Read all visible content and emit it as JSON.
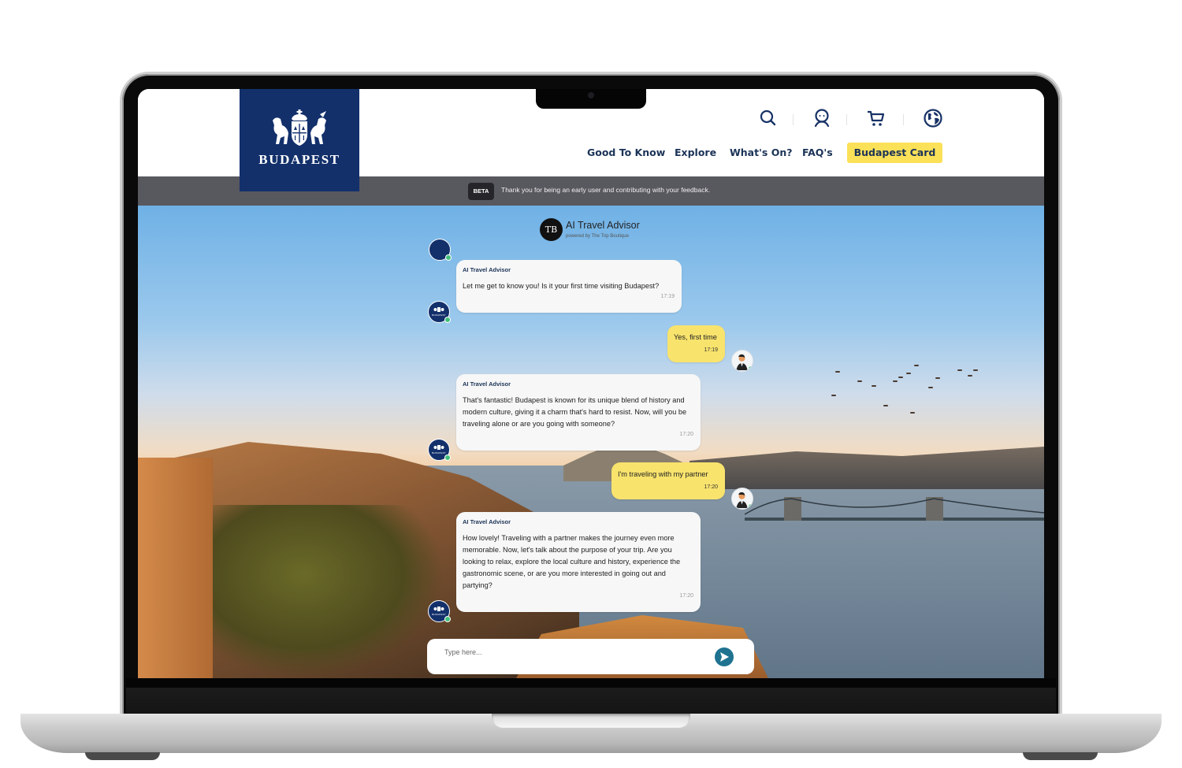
{
  "site": {
    "logo_text": "BUDAPEST",
    "header_icons": [
      {
        "name": "search-icon",
        "label": "Search"
      },
      {
        "name": "account-icon",
        "label": "Account"
      },
      {
        "name": "cart-icon",
        "label": "Cart"
      },
      {
        "name": "globe-icon",
        "label": "Language"
      }
    ],
    "nav": [
      {
        "label": "Good To Know"
      },
      {
        "label": "Explore"
      },
      {
        "label": "What's On?"
      },
      {
        "label": "FAQ's"
      }
    ],
    "cta_label": "Budapest Card",
    "colors": {
      "brand_navy": "#13306b",
      "cta_yellow": "#fbe158",
      "nav_text": "#1b3357"
    }
  },
  "beta_bar": {
    "badge": "BETA",
    "message": "Thank you for being an early user and contributing with your feedback."
  },
  "chat": {
    "logo_text": "TB",
    "title": "AI Travel Advisor",
    "subtitle": "powered by The Trip Boutique",
    "messages": [
      {
        "from": "bot",
        "sender": "AI Travel Advisor",
        "text": "Let me get to know you! Is it your first time visiting Budapest?",
        "time": "17:19"
      },
      {
        "from": "user",
        "text": "Yes, first time",
        "time": "17:19"
      },
      {
        "from": "bot",
        "sender": "AI Travel Advisor",
        "text": "That's fantastic! Budapest is known for its unique blend of history and modern culture, giving it a charm that's hard to resist. Now, will you be traveling alone or are you going with someone?",
        "time": "17:20"
      },
      {
        "from": "user",
        "text": "I'm traveling with my partner",
        "time": "17:20"
      },
      {
        "from": "bot",
        "sender": "AI Travel Advisor",
        "text": "How lovely! Traveling with a partner makes the journey even more memorable. Now, let's talk about the purpose of your trip. Are you looking to relax, explore the local culture and history, experience the gastronomic scene, or are you more interested in going out and partying?",
        "time": "17:20"
      }
    ],
    "bot_avatar_text": "BUDAPEST",
    "composer": {
      "placeholder": "Type here...",
      "value": ""
    },
    "colors": {
      "user_bubble": "#f8e36d",
      "bot_bubble": "#f7f7f7",
      "send_button": "#1f7391",
      "online": "#43c07b"
    }
  }
}
